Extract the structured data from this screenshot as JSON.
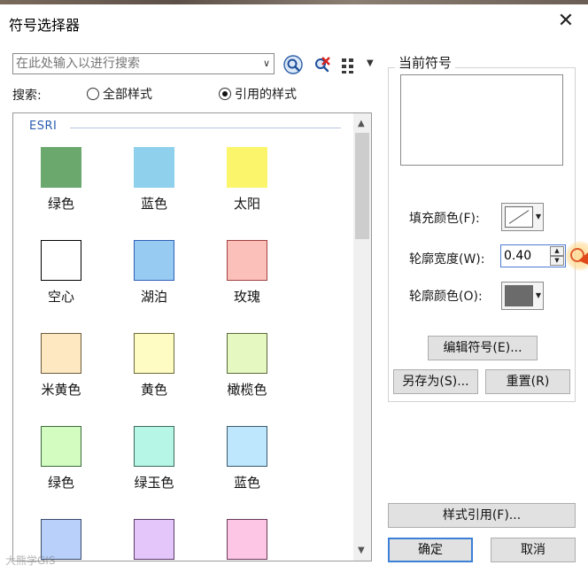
{
  "dialog": {
    "title": "符号选择器"
  },
  "search": {
    "placeholder": "在此处输入以进行搜索",
    "scope_label": "搜索:",
    "options": [
      "全部样式",
      "引用的样式"
    ],
    "selected": "引用的样式"
  },
  "gallery": {
    "group": "ESRI",
    "items": [
      {
        "name": "绿色",
        "fill": "#6aa86e",
        "outline": "#6aa86e"
      },
      {
        "name": "蓝色",
        "fill": "#8fd0ec",
        "outline": "#8fd0ec"
      },
      {
        "name": "太阳",
        "fill": "#fbf56b",
        "outline": "#fbf56b"
      },
      {
        "name": "空心",
        "fill": "#ffffff",
        "outline": "#000000"
      },
      {
        "name": "湖泊",
        "fill": "#97cbf2",
        "outline": "#2f5fb8"
      },
      {
        "name": "玫瑰",
        "fill": "#fcc0ba",
        "outline": "#a04040"
      },
      {
        "name": "米黄色",
        "fill": "#fde8c2",
        "outline": "#6a5a3a"
      },
      {
        "name": "黄色",
        "fill": "#fefcc2",
        "outline": "#6a6a3a"
      },
      {
        "name": "橄榄色",
        "fill": "#e6f8c2",
        "outline": "#5a6a3a"
      },
      {
        "name": "绿色",
        "fill": "#d2fcc0",
        "outline": "#3a6a3a"
      },
      {
        "name": "绿玉色",
        "fill": "#b6f6e6",
        "outline": "#3a6a5a"
      },
      {
        "name": "蓝色",
        "fill": "#bee6fc",
        "outline": "#3a5a6a"
      },
      {
        "name": "",
        "fill": "#b8d0fa",
        "outline": "#3a4a6a"
      },
      {
        "name": "",
        "fill": "#e4c6fa",
        "outline": "#5a3a6a"
      },
      {
        "name": "",
        "fill": "#fcc6e4",
        "outline": "#6a3a5a"
      }
    ]
  },
  "current_symbol": {
    "title": "当前符号",
    "fill_label": "填充颜色(F):",
    "fill_color": "none",
    "outline_width_label": "轮廓宽度(W):",
    "outline_width": "0.40",
    "outline_color_label": "轮廓颜色(O):",
    "outline_color": "#6b6b6b",
    "edit_button": "编辑符号(E)...",
    "save_as_button": "另存为(S)...",
    "reset_button": "重置(R)"
  },
  "footer": {
    "style_ref_button": "样式引用(F)...",
    "ok_button": "确定",
    "cancel_button": "取消"
  },
  "watermark": "大熊学GIS",
  "icons": {
    "search": "search-icon",
    "clear": "clear-search-icon",
    "view": "grid-view-icon",
    "close": "close-icon"
  }
}
